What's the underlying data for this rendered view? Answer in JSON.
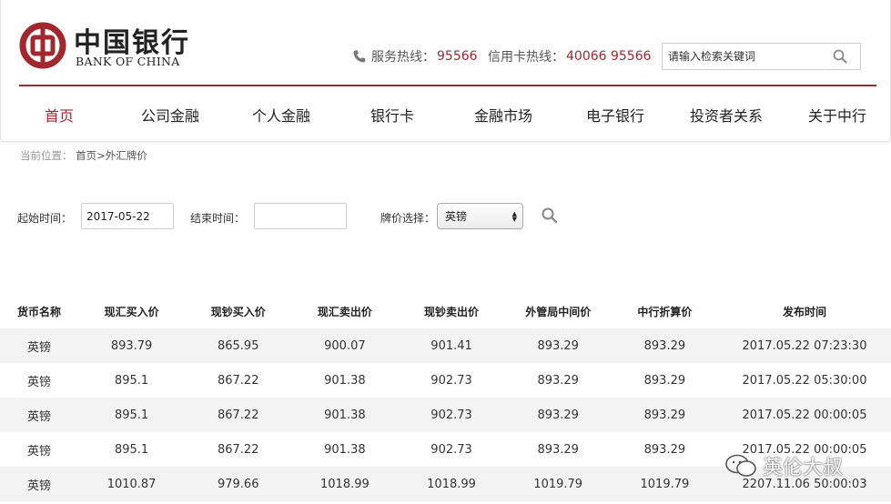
{
  "header": {
    "logo_cn": "中国银行",
    "logo_en": "BANK OF CHINA",
    "service_hotline_label": "服务热线：",
    "service_hotline_number": "95566",
    "card_hotline_label": "信用卡热线：",
    "card_hotline_number": "40066 95566",
    "search_placeholder": "请输入检索关键词",
    "brand_color": "#a1282e"
  },
  "nav": {
    "items": [
      {
        "label": "首页",
        "active": true
      },
      {
        "label": "公司金融"
      },
      {
        "label": "个人金融"
      },
      {
        "label": "银行卡"
      },
      {
        "label": "金融市场"
      },
      {
        "label": "电子银行"
      },
      {
        "label": "投资者关系"
      },
      {
        "label": "关于中行"
      }
    ]
  },
  "breadcrumb": {
    "label": "当前位置：",
    "path": "首页>外汇牌价"
  },
  "filters": {
    "start_label": "起始时间：",
    "start_value": "2017-05-22",
    "end_label": "结束时间：",
    "end_value": "",
    "currency_label": "牌价选择：",
    "currency_value": "英镑"
  },
  "table": {
    "headers": [
      "货币名称",
      "现汇买入价",
      "现钞买入价",
      "现汇卖出价",
      "现钞卖出价",
      "外管局中间价",
      "中行折算价",
      "发布时间"
    ],
    "rows": [
      [
        "英镑",
        "893.79",
        "865.95",
        "900.07",
        "901.41",
        "893.29",
        "893.29",
        "2017.05.22 07:23:30"
      ],
      [
        "英镑",
        "895.1",
        "867.22",
        "901.38",
        "902.73",
        "893.29",
        "893.29",
        "2017.05.22 05:30:00"
      ],
      [
        "英镑",
        "895.1",
        "867.22",
        "901.38",
        "902.73",
        "893.29",
        "893.29",
        "2017.05.22 00:00:05"
      ],
      [
        "英镑",
        "895.1",
        "867.22",
        "901.38",
        "902.73",
        "893.29",
        "893.29",
        "2017.05.22 00:00:05"
      ],
      [
        "英镑",
        "1010.87",
        "979.66",
        "1018.99",
        "1018.99",
        "1019.79",
        "1019.79",
        "2207.11.06 50:00:03"
      ]
    ]
  },
  "watermark": {
    "text": "英伦大叔"
  }
}
